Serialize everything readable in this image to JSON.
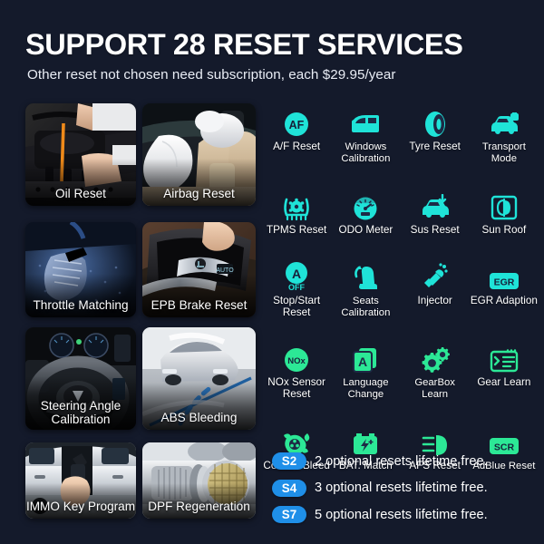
{
  "header": {
    "title": "SUPPORT 28 RESET SERVICES",
    "subtitle": "Other reset not chosen need subscription, each $29.95/year"
  },
  "colors": {
    "background_dark": "#1a2035",
    "background_light": "#2c3a61",
    "icon_teal": "#1fe3d8",
    "icon_green": "#2ce896",
    "badge_blue": "#1f8fe8",
    "text_white": "#ffffff"
  },
  "photo_tiles": [
    {
      "caption": "Oil Reset",
      "icon": "engine-oil-dipstick-photo"
    },
    {
      "caption": "Airbag Reset",
      "icon": "deployed-airbags-photo"
    },
    {
      "caption": "Throttle Matching",
      "icon": "accelerator-pedal-photo"
    },
    {
      "caption": "EPB Brake Reset",
      "icon": "electronic-parking-brake-switch-photo"
    },
    {
      "caption": "Steering Angle Calibration",
      "icon": "steering-wheel-photo"
    },
    {
      "caption": "ABS Bleeding",
      "icon": "car-braking-trajectory-photo"
    },
    {
      "caption": "IMMO Key Program",
      "icon": "car-key-fob-photo"
    },
    {
      "caption": "DPF Regeneration",
      "icon": "diesel-particulate-filter-photo"
    }
  ],
  "reset_icons": [
    {
      "label": "A/F Reset",
      "icon": "af-circle-icon",
      "color": "teal"
    },
    {
      "label": "Windows Calibration",
      "icon": "car-window-icon",
      "color": "teal"
    },
    {
      "label": "Tyre Reset",
      "icon": "tyre-icon",
      "color": "teal"
    },
    {
      "label": "Transport Mode",
      "icon": "car-lock-icon",
      "color": "teal"
    },
    {
      "label": "TPMS Reset",
      "icon": "tpms-pressure-icon",
      "color": "teal"
    },
    {
      "label": "ODO Meter",
      "icon": "odometer-gauge-icon",
      "color": "teal"
    },
    {
      "label": "Sus Reset",
      "icon": "car-suspension-icon",
      "color": "teal"
    },
    {
      "label": "Sun Roof",
      "icon": "sunroof-icon",
      "color": "teal"
    },
    {
      "label": "Stop/Start Reset",
      "icon": "a-off-circle-icon",
      "color": "teal"
    },
    {
      "label": "Seats Calibration",
      "icon": "car-seat-icon",
      "color": "teal"
    },
    {
      "label": "Injector",
      "icon": "fuel-injector-icon",
      "color": "teal"
    },
    {
      "label": "EGR Adaption",
      "icon": "egr-badge-icon",
      "color": "teal"
    },
    {
      "label": "NOx Sensor Reset",
      "icon": "nox-circle-icon",
      "color": "green"
    },
    {
      "label": "Language Change",
      "icon": "language-a-book-icon",
      "color": "green"
    },
    {
      "label": "GearBox Learn",
      "icon": "gears-icon",
      "color": "green"
    },
    {
      "label": "Gear Learn",
      "icon": "gear-learn-list-icon",
      "color": "green"
    },
    {
      "label": "Coolant Bleed",
      "icon": "coolant-fan-icon",
      "color": "green"
    },
    {
      "label": "BAT. Match",
      "icon": "battery-icon",
      "color": "green"
    },
    {
      "label": "AFS Reset",
      "icon": "headlight-icon",
      "color": "green"
    },
    {
      "label": "AdBlue Reset",
      "icon": "scr-badge-icon",
      "color": "green"
    }
  ],
  "subscription_tiers": [
    {
      "badge": "S2",
      "text": "2 optional resets lifetime free."
    },
    {
      "badge": "S4",
      "text": "3 optional resets lifetime free."
    },
    {
      "badge": "S7",
      "text": "5 optional resets lifetime free."
    }
  ]
}
